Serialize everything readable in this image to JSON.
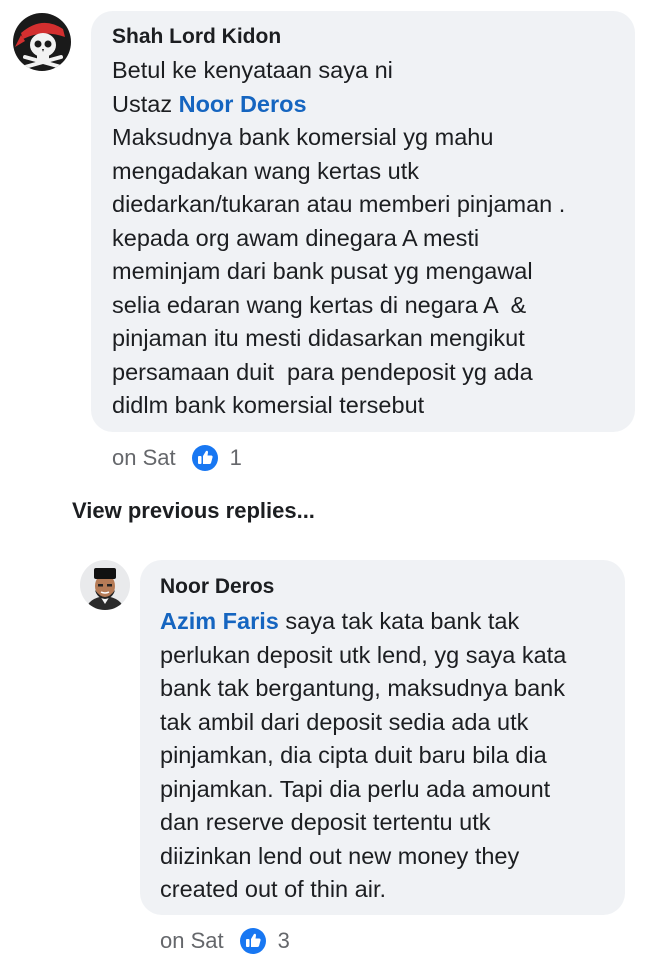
{
  "comment1": {
    "author": "Shah  Lord  Kidon",
    "line1": "Betul ke kenyataan saya ni",
    "line2_prefix": "Ustaz ",
    "mention": "Noor Deros",
    "body_lines": [
      "Maksudnya bank komersial yg mahu",
      "mengadakan wang kertas utk",
      "diedarkan/tukaran atau memberi pinjaman .",
      "kepada org awam dinegara A mesti",
      "meminjam dari bank pusat yg mengawal",
      "selia edaran wang kertas di negara A  &",
      "pinjaman itu mesti didasarkan mengikut",
      "persamaan duit  para pendeposit yg ada",
      "didlm bank komersial tersebut"
    ],
    "time": "on Sat",
    "likes": "1",
    "avatar_icon": "pirate-skull-avatar"
  },
  "view_previous": "View previous replies...",
  "comment2": {
    "author": "Noor Deros",
    "mention": "Azim Faris",
    "first_line_rest": " saya tak kata bank tak",
    "body_lines": [
      "perlukan deposit utk lend, yg saya kata",
      "bank tak bergantung, maksudnya bank",
      "tak ambil dari deposit sedia ada utk",
      "pinjamkan, dia cipta duit baru bila dia",
      "pinjamkan. Tapi dia perlu ada amount",
      "dan reserve deposit tertentu utk",
      "diizinkan lend out new money they",
      "created out of thin air."
    ],
    "time": "on Sat",
    "likes": "3",
    "avatar_icon": "man-with-songkok-avatar"
  },
  "colors": {
    "bubble_bg": "#f0f2f5",
    "mention": "#1565c0",
    "like_blue": "#1877f2",
    "meta_gray": "#65676b"
  }
}
